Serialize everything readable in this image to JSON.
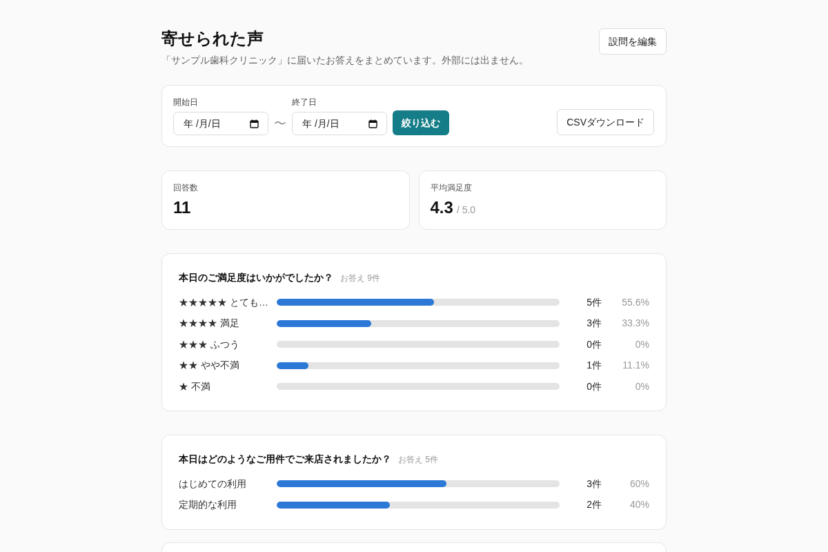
{
  "header": {
    "title": "寄せられた声",
    "subtitle": "「サンプル歯科クリニック」に届いたお答えをまとめています。外部には出ません。",
    "edit_button": "設問を編集"
  },
  "filter": {
    "start": {
      "label": "開始日",
      "placeholder": "年 /月/日"
    },
    "separator": "〜",
    "end": {
      "label": "終了日",
      "placeholder": "年 /月/日"
    },
    "apply_button": "絞り込む",
    "download_button": "CSVダウンロード"
  },
  "stats": [
    {
      "label": "回答数",
      "value": "11"
    },
    {
      "label": "平均満足度",
      "value": "4.3",
      "suffix": "/ 5.0"
    }
  ],
  "questions": [
    {
      "title": "本日のご満足度はいかがでしたか？",
      "meta": "お答え 9件",
      "options": [
        {
          "label": "★★★★★ とても…",
          "level": 0.556,
          "count": "5件",
          "percent": "55.6%"
        },
        {
          "label": "★★★★ 満足",
          "level": 0.333,
          "count": "3件",
          "percent": "33.3%"
        },
        {
          "label": "★★★ ふつう",
          "count": "0件",
          "percent": "0%"
        },
        {
          "label": "★★ やや不満",
          "level": 0.111,
          "count": "1件",
          "percent": "11.1%"
        },
        {
          "label": "★ 不満",
          "count": "0件",
          "percent": "0%"
        }
      ]
    },
    {
      "title": "本日はどのようなご用件でご来店されましたか？",
      "meta": "お答え 5件",
      "options": [
        {
          "label": "はじめての利用",
          "level": 0.6,
          "count": "3件",
          "percent": "60%"
        },
        {
          "label": "定期的な利用",
          "level": 0.4,
          "count": "2件",
          "percent": "40%"
        }
      ]
    }
  ]
}
